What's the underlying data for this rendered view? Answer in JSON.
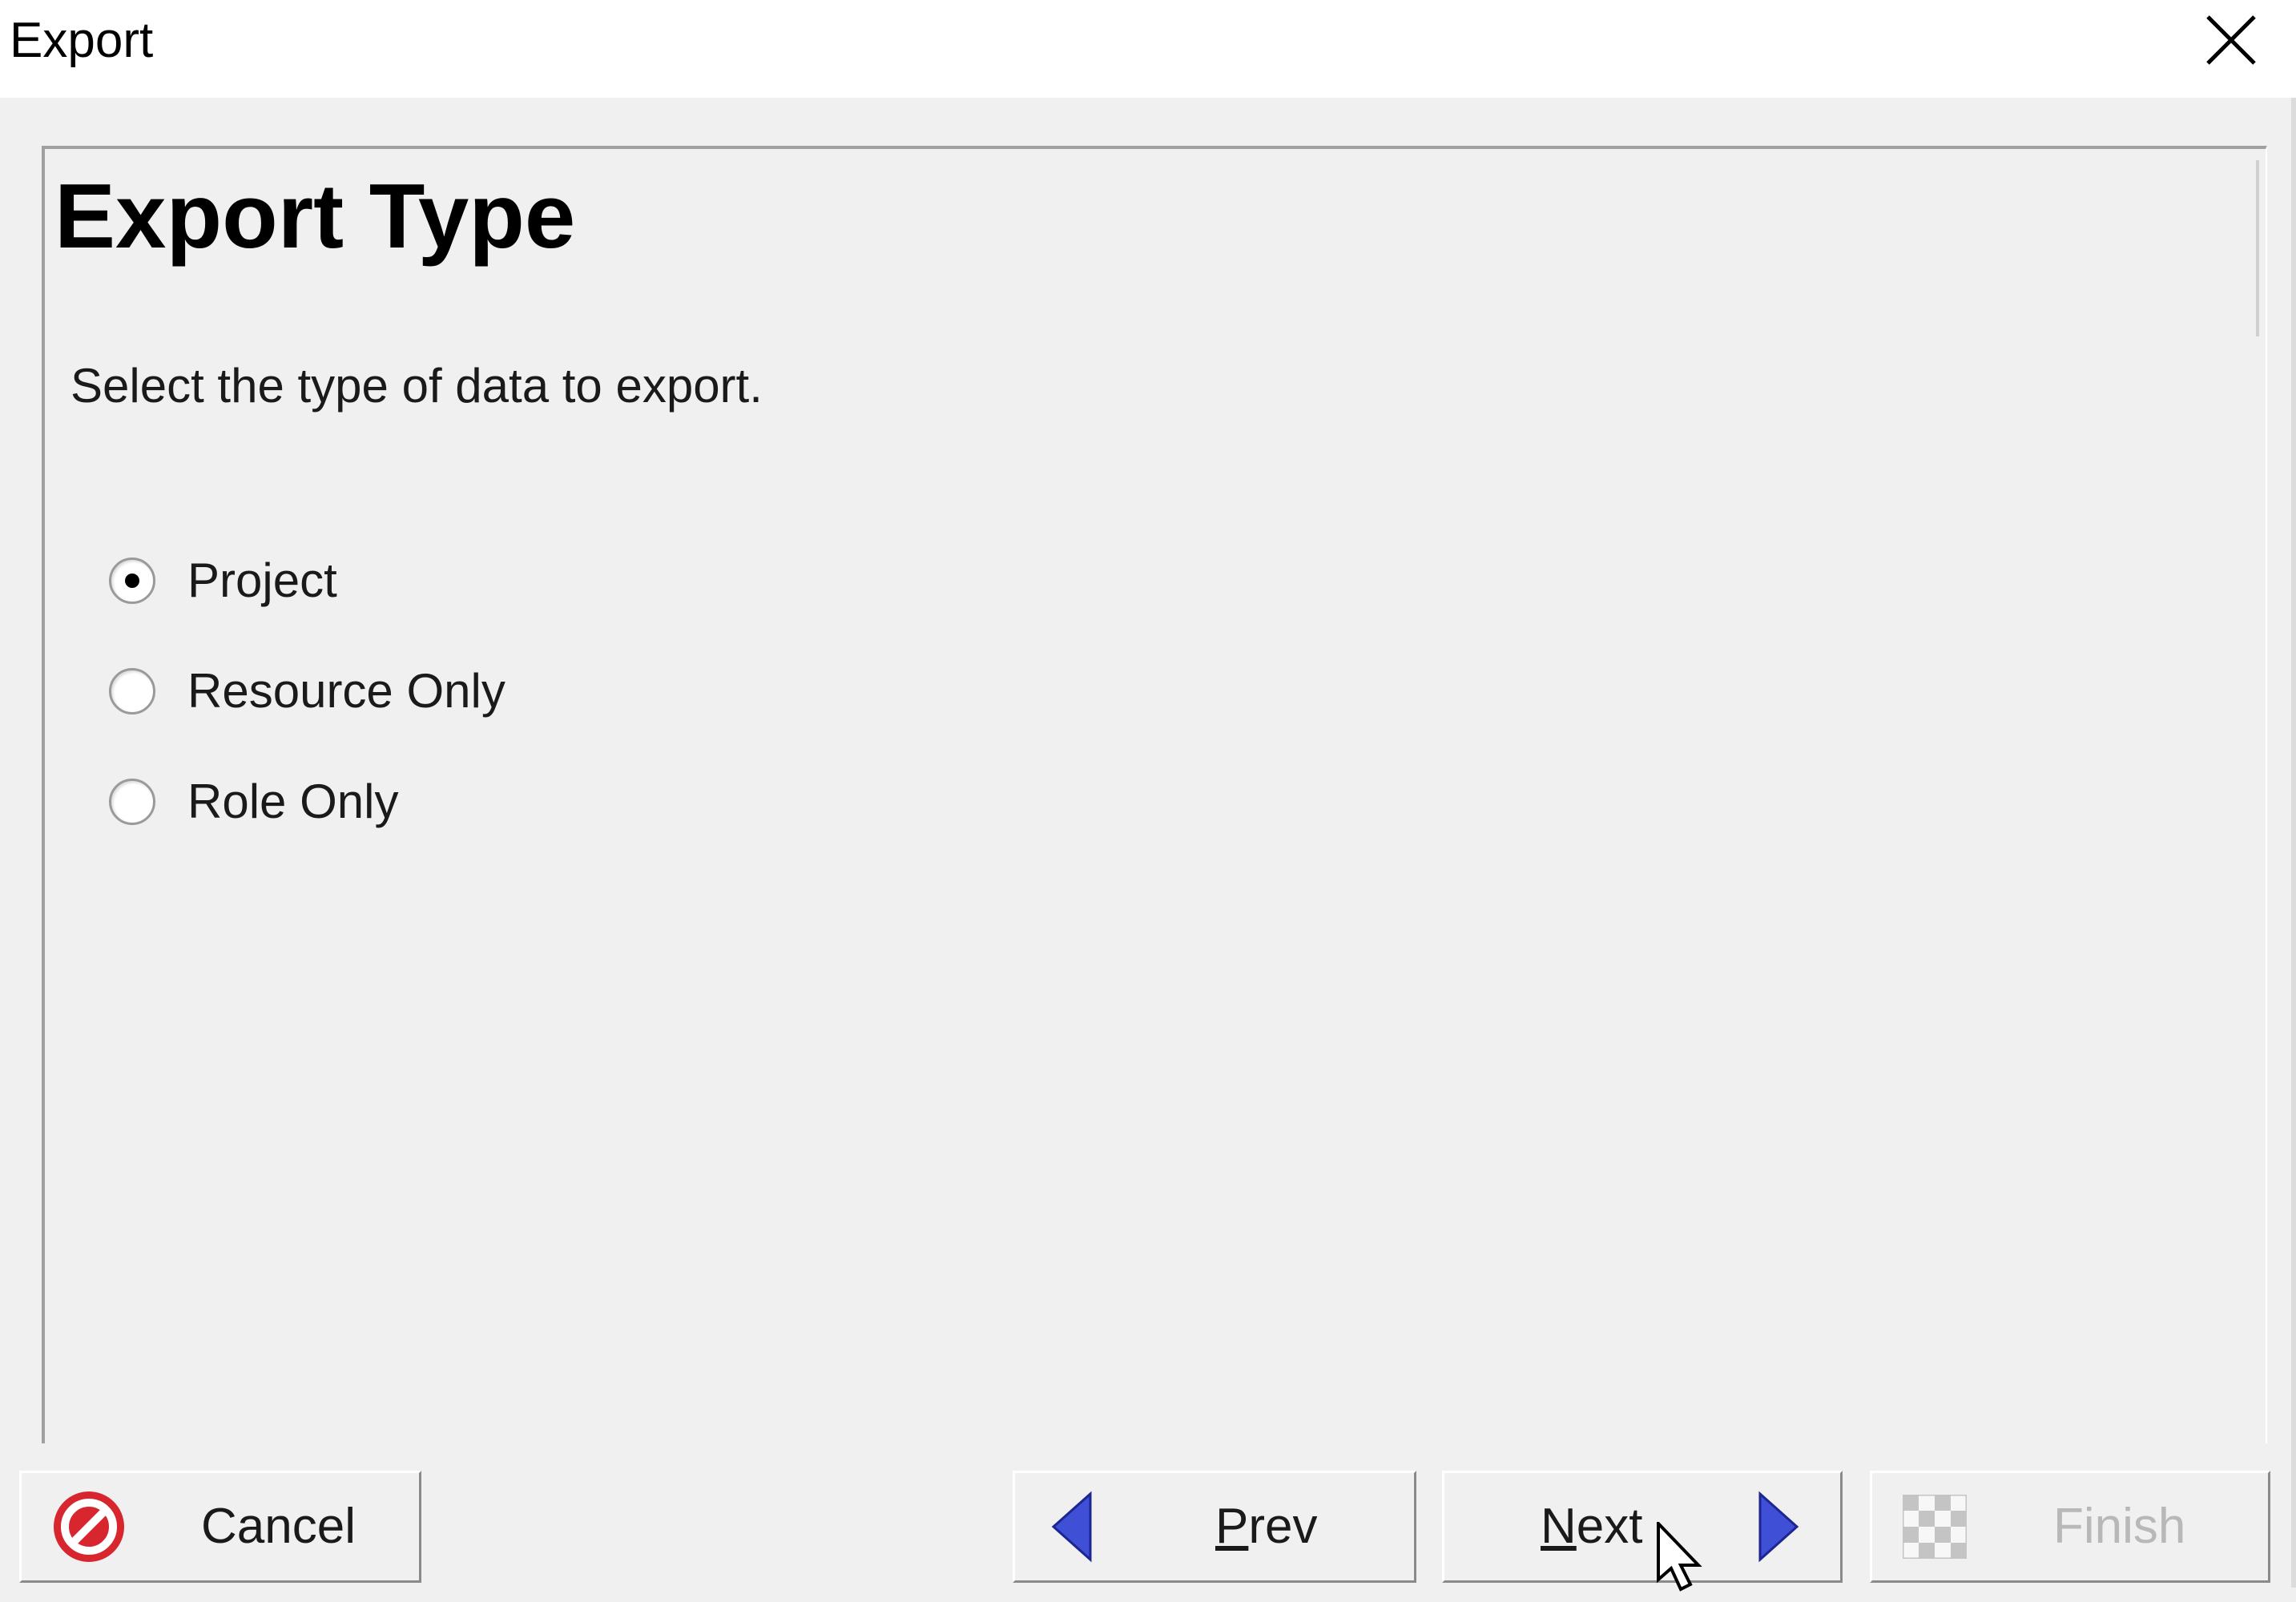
{
  "window": {
    "title": "Export"
  },
  "page": {
    "heading": "Export Type",
    "instruction": "Select the type of data to export."
  },
  "options": [
    {
      "label": "Project",
      "checked": true
    },
    {
      "label": "Resource Only",
      "checked": false
    },
    {
      "label": "Role Only",
      "checked": false
    }
  ],
  "buttons": {
    "cancel": {
      "label": "Cancel",
      "icon": "cancel-icon"
    },
    "prev": {
      "label_mnemonic": "P",
      "label_rest": "rev",
      "icon": "left-arrow-icon"
    },
    "next": {
      "label_mnemonic": "N",
      "label_rest": "ext",
      "icon": "right-arrow-icon"
    },
    "finish": {
      "label": "Finish",
      "icon": "checkered-flag-icon",
      "enabled": false
    }
  },
  "colors": {
    "arrow": "#3f4fd6",
    "cancel_red": "#d7262e",
    "window_bg": "#f0f0f0"
  }
}
